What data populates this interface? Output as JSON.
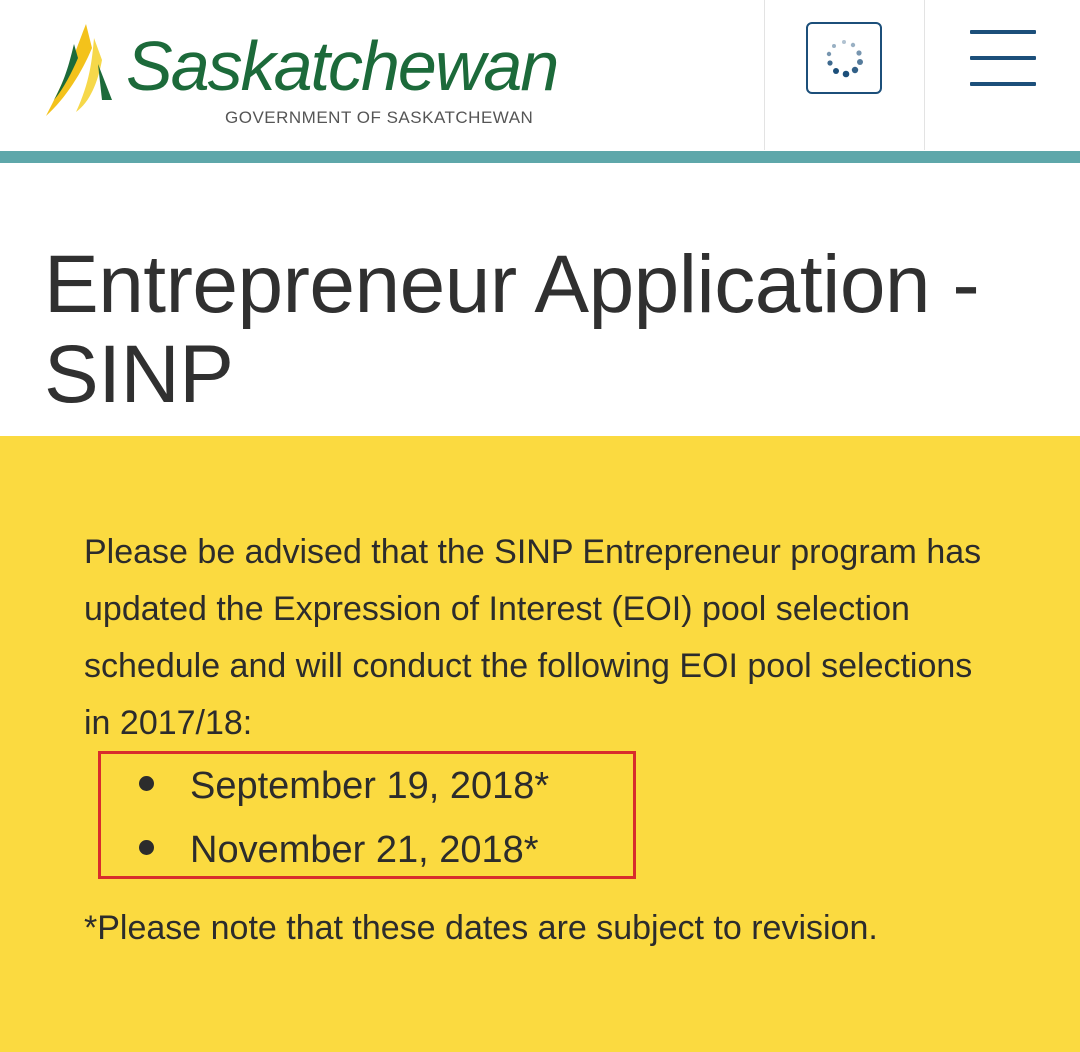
{
  "header": {
    "logo_text": "Saskatchewan",
    "logo_subtitle": "GOVERNMENT OF SASKATCHEWAN",
    "loading_icon": "spinner-icon",
    "menu_icon": "hamburger-menu-icon",
    "accent_color": "#1c4f7a",
    "strip_color": "#5ea7aa"
  },
  "page": {
    "title": "Entrepreneur Application - SINP"
  },
  "notice": {
    "background_color": "#fbda40",
    "intro": "Please be advised that the SINP Entrepreneur program has updated the Expression of Interest (EOI) pool selection schedule and will conduct the following EOI pool selections in 2017/18:",
    "dates": [
      "September 19, 2018*",
      "November 21, 2018*"
    ],
    "highlight_color": "#d82c2c",
    "footnote": "*Please note that these dates are subject to revision."
  }
}
